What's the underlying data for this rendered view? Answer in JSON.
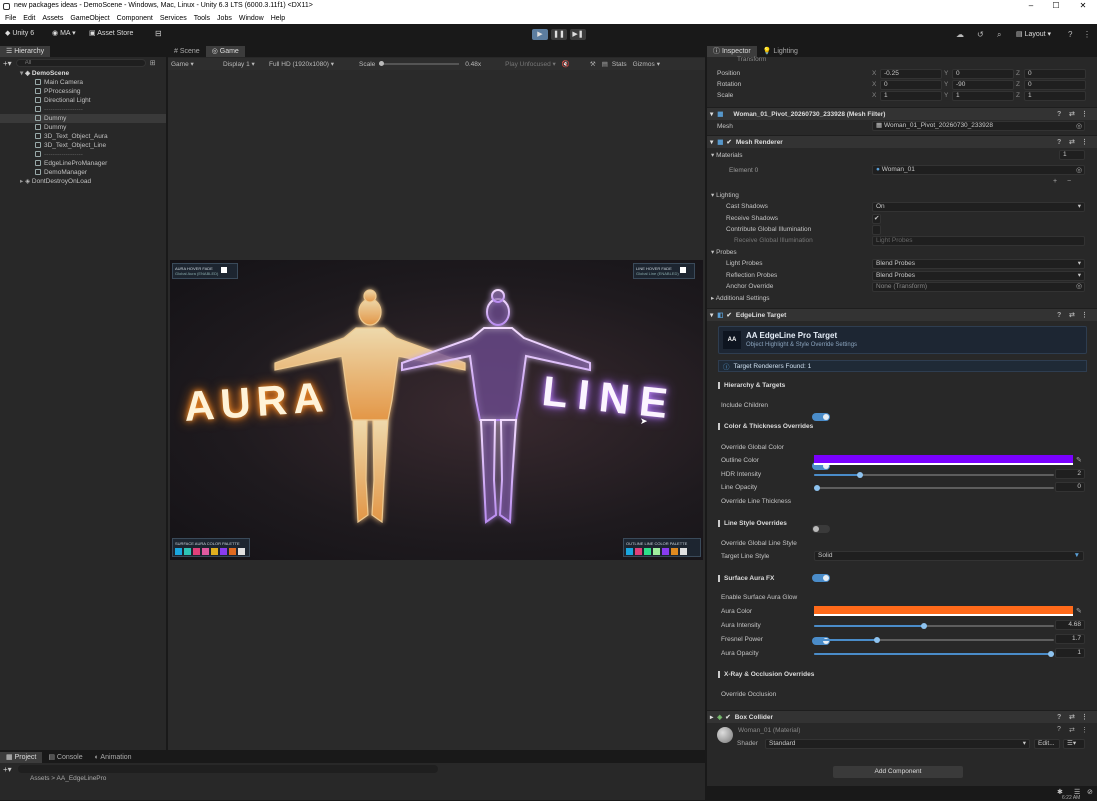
{
  "window": {
    "title": "new packages ideas - DemoScene - Windows, Mac, Linux - Unity 6.3 LTS (6000.3.11f1) <DX11>",
    "min": "–",
    "max": "☐",
    "close": "✕"
  },
  "menu": [
    "File",
    "Edit",
    "Assets",
    "GameObject",
    "Component",
    "Services",
    "Tools",
    "Jobs",
    "Window",
    "Help"
  ],
  "toolbar": {
    "unity": "Unity 6",
    "account": "MA",
    "asset_store": "Asset Store",
    "play": "▶",
    "pause": "❚❚",
    "step": "▶❚",
    "layout": "Layout"
  },
  "hierarchy": {
    "tab": "Hierarchy",
    "search_placeholder": "All",
    "scene": "DemoScene",
    "items": [
      "Main Camera",
      "PProcessing",
      "Directional Light",
      "------------------",
      "Dummy",
      "Dummy",
      "3D_Text_Object_Aura",
      "3D_Text_Object_Line",
      "------------------",
      "EdgeLineProManager",
      "DemoManager"
    ],
    "dont_destroy": "DontDestroyOnLoad"
  },
  "game": {
    "tabs": [
      "Scene",
      "Game"
    ],
    "mode": "Game",
    "display": "Display 1",
    "resolution": "Full HD (1920x1080)",
    "scale_label": "Scale",
    "scale_value": "0.48x",
    "play_unfocused": "Play Unfocused",
    "stats": "Stats",
    "gizmos": "Gizmos"
  },
  "render": {
    "word_left": "AURA",
    "word_right": "LINE",
    "hud_tl": "AURA HOVER FADE",
    "hud_tl_sub": "Global Aura (ENABLED)",
    "hud_tr": "LINE HOVER FADE",
    "hud_tr_sub": "Global Line (ENABLED)",
    "hud_bl": "SURFACE AURA COLOR PALETTE",
    "hud_br": "OUTLINE LINE COLOR PALETTE",
    "palette_left": [
      "#1aa7e0",
      "#2ec4b6",
      "#e0407a",
      "#e05aa0",
      "#e0b020",
      "#8a3cf0",
      "#e06a20",
      "#e0e0e0"
    ],
    "palette_right": [
      "#1aa7e0",
      "#e0407a",
      "#2ee08a",
      "#a0f0a0",
      "#8a3cf0",
      "#e08a20",
      "#e0e0e0"
    ]
  },
  "bottom": {
    "tabs": [
      "Project",
      "Console",
      "Animation"
    ],
    "path": "Assets > AA_EdgeLinePro"
  },
  "inspector": {
    "tabs": [
      "Inspector",
      "Lighting"
    ],
    "transform": {
      "title": "Transform",
      "position": {
        "label": "Position",
        "x": "-0.25",
        "y": "0",
        "z": "0"
      },
      "rotation": {
        "label": "Rotation",
        "x": "0",
        "y": "-90",
        "z": "0"
      },
      "scale": {
        "label": "Scale",
        "x": "1",
        "y": "1",
        "z": "1"
      }
    },
    "mesh_filter": {
      "title": "Woman_01_Pivot_20260730_233928 (Mesh Filter)",
      "mesh_label": "Mesh",
      "mesh_value": "Woman_01_Pivot_20260730_233928"
    },
    "mesh_renderer": {
      "title": "Mesh Renderer",
      "materials": "Materials",
      "materials_count": "1",
      "element0": "Element 0",
      "element0_value": "Woman_01",
      "lighting": "Lighting",
      "cast_shadows": "Cast Shadows",
      "cast_shadows_value": "On",
      "receive_shadows": "Receive Shadows",
      "contribute_gi": "Contribute Global Illumination",
      "receive_gi": "Receive Global Illumination",
      "receive_gi_value": "Light Probes",
      "probes": "Probes",
      "light_probes": "Light Probes",
      "light_probes_value": "Blend Probes",
      "reflection_probes": "Reflection Probes",
      "reflection_probes_value": "Blend Probes",
      "anchor_override": "Anchor Override",
      "anchor_override_value": "None (Transform)",
      "additional": "Additional Settings"
    },
    "edgeline": {
      "title": "EdgeLine Target",
      "banner_title": "AA EdgeLine Pro Target",
      "banner_sub": "Object Highlight & Style Override Settings",
      "found": "Target Renderers Found: 1",
      "s1": "Hierarchy & Targets",
      "include_children": "Include Children",
      "s2": "Color & Thickness Overrides",
      "override_color": "Override Global Color",
      "outline_color_label": "Outline Color",
      "outline_color": "#7a00ff",
      "hdr_label": "HDR Intensity",
      "hdr_value": "2",
      "line_opacity_label": "Line Opacity",
      "line_opacity_value": "0",
      "override_thickness": "Override Line Thickness",
      "s3": "Line Style Overrides",
      "override_style": "Override Global Line Style",
      "target_style_label": "Target Line Style",
      "target_style_value": "Solid",
      "s4": "Surface Aura FX",
      "enable_aura": "Enable Surface Aura Glow",
      "aura_color_label": "Aura Color",
      "aura_color": "#ff6a1a",
      "aura_intensity_label": "Aura Intensity",
      "aura_intensity_value": "4.68",
      "fresnel_label": "Fresnel Power",
      "fresnel_value": "1.7",
      "aura_opacity_label": "Aura Opacity",
      "aura_opacity_value": "1",
      "s5": "X-Ray & Occlusion Overrides",
      "override_occlusion": "Override Occlusion"
    },
    "box_collider": "Box Collider",
    "material": {
      "title": "Woman_01 (Material)",
      "shader_label": "Shader",
      "shader_value": "Standard",
      "edit": "Edit..."
    },
    "add_component": "Add Component"
  },
  "status": {
    "time": "6:22 AM"
  }
}
